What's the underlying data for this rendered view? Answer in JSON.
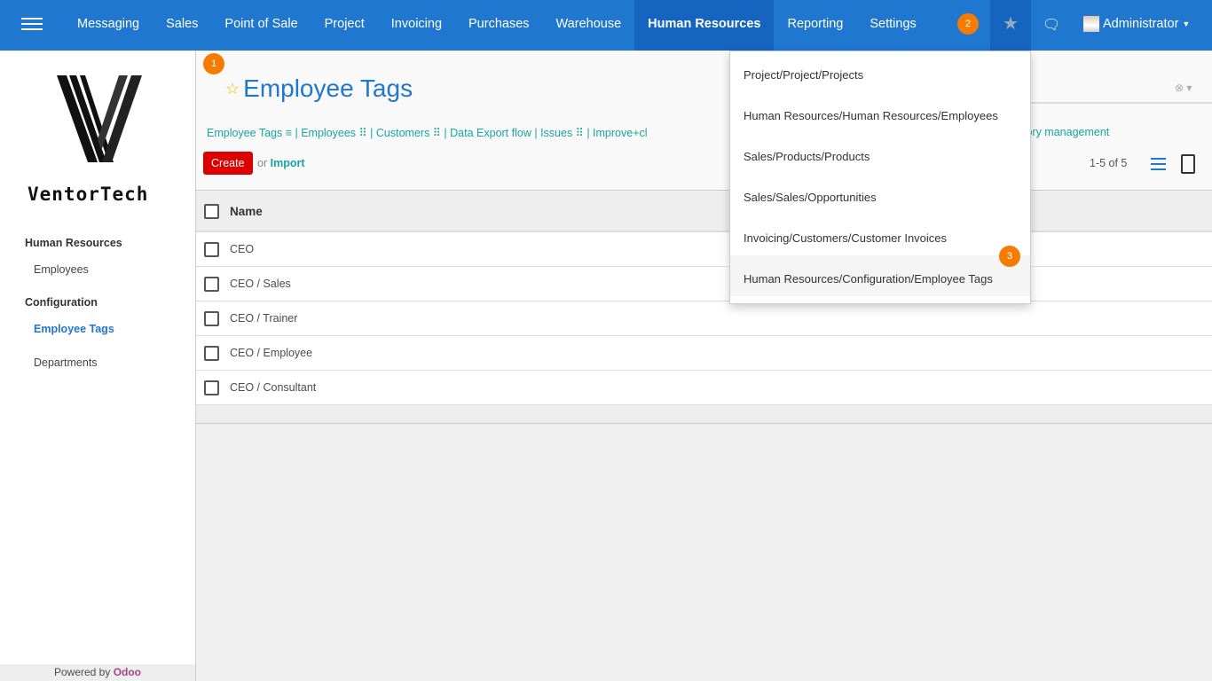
{
  "navbar": {
    "menu": [
      "Messaging",
      "Sales",
      "Point of Sale",
      "Project",
      "Invoicing",
      "Purchases",
      "Warehouse",
      "Human Resources",
      "Reporting",
      "Settings"
    ],
    "active": "Human Resources",
    "user": "Administrator",
    "badge_tour": "2",
    "color": "#1f77d0"
  },
  "sidebar": {
    "brand": "VentorTech",
    "section1": "Human Resources",
    "item1": "Employees",
    "section2": "Configuration",
    "item2": "Employee Tags",
    "item3": "Departments",
    "powered_prefix": "Powered by",
    "powered_brand": "Odoo"
  },
  "control": {
    "badge": "1",
    "title": "Employee Tags",
    "favorites": [
      "Employee Tags ≡",
      "Employees ⠿",
      "Customers ⠿",
      "Data Export flow",
      "Issues ⠿",
      "Improve+cl"
    ],
    "favorites_tail": "tory management",
    "create": "Create",
    "or": "or",
    "import": "Import",
    "pager": "1-5 of 5"
  },
  "table": {
    "header": "Name",
    "rows": [
      "CEO",
      "CEO / Sales",
      "CEO / Trainer",
      "CEO / Employee",
      "CEO / Consultant"
    ]
  },
  "dropdown": {
    "items": [
      "Project/Project/Projects",
      "Human Resources/Human Resources/Employees",
      "Sales/Products/Products",
      "Sales/Sales/Opportunities",
      "Invoicing/Customers/Customer Invoices",
      "Human Resources/Configuration/Employee Tags"
    ],
    "badge": "3"
  }
}
